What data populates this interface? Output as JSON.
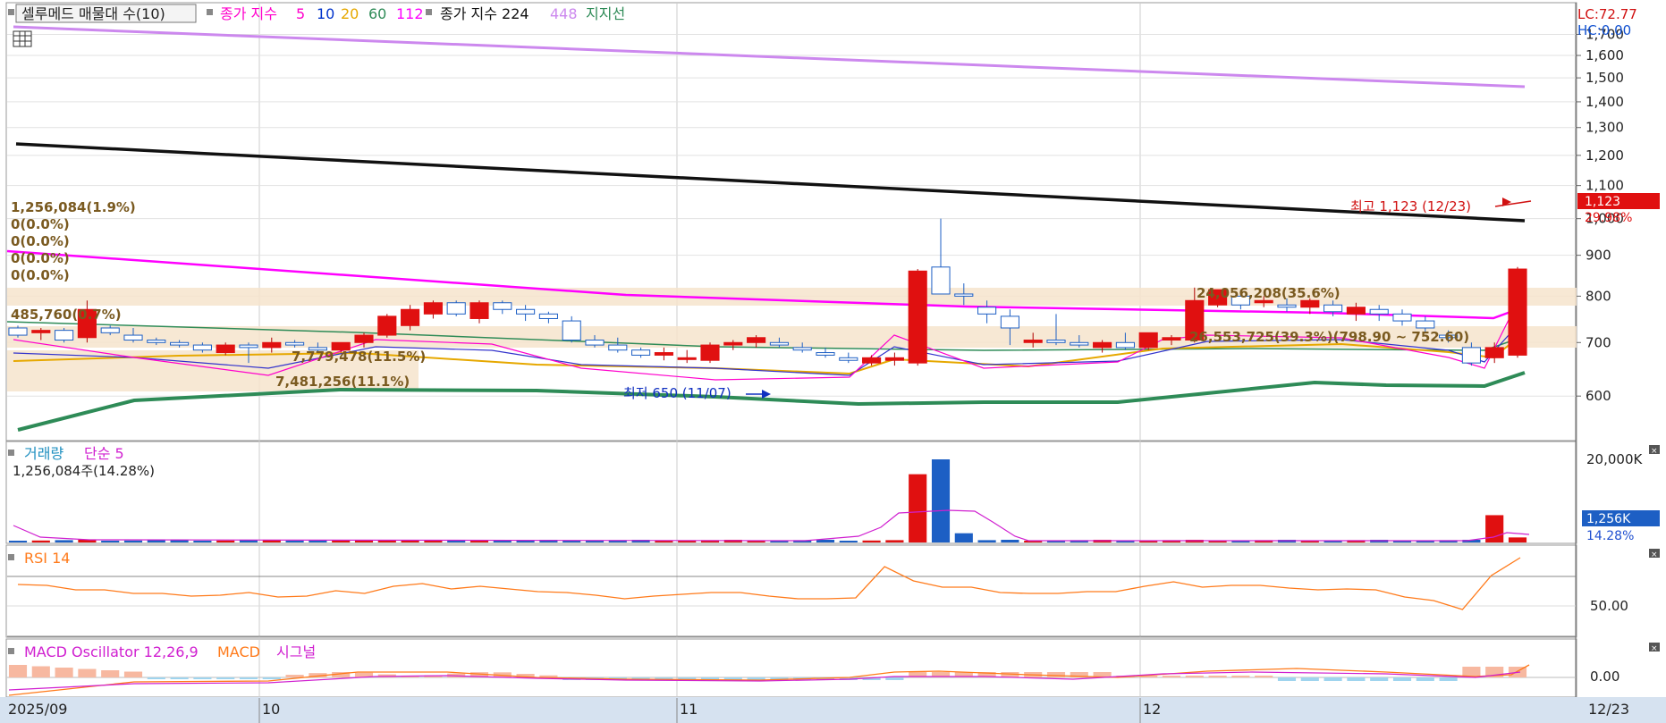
{
  "header": {
    "volume_profile_btn": "셀루메드 매물대 수(10)",
    "ma_label": "종가 지수",
    "ma_periods": [
      "5",
      "10",
      "20",
      "60",
      "112"
    ],
    "ma_colors": [
      "#ff00cc",
      "#0033cc",
      "#e6a800",
      "#2e8b57",
      "#ff00ff"
    ],
    "ma2_label": "종가 지수 224",
    "ma2_period_448": "448",
    "support_line": "지지선",
    "lc": "LC:72.77",
    "hc": "HC:0.00"
  },
  "price_panel": {
    "y_ticks": [
      "1,700",
      "1,600",
      "1,500",
      "1,400",
      "1,300",
      "1,200",
      "1,100",
      "1,000",
      "900",
      "800",
      "700",
      "600"
    ],
    "last_price_box": "1,123",
    "last_price_pct": "29.98%",
    "high_annotation": "최고 1,123 (12/23)",
    "low_annotation": "최저 650 (11/07)",
    "range_annotation": "26,553,725(39.3%)(798.90 ~ 752.60)",
    "profile_labels": [
      "1,256,084(1.9%)",
      "0(0.0%)",
      "0(0.0%)",
      "0(0.0%)",
      "0(0.0%)",
      "24,056,208(35.6%)",
      "485,760(0.7%)",
      "7,779,478(11.5%)",
      "7,481,256(11.1%)"
    ]
  },
  "volume_panel": {
    "title": "거래량",
    "ma_label": "단순 5",
    "current": "1,256,084주(14.28%)",
    "y_tick": "20,000K",
    "last_box": "1,256K",
    "last_pct": "14.28%"
  },
  "rsi_panel": {
    "title": "RSI 14",
    "y_tick": "50.00"
  },
  "macd_panel": {
    "title": "MACD Oscillator 12,26,9",
    "macd": "MACD",
    "signal": "시그널",
    "y_tick": "0.00"
  },
  "x_axis": {
    "labels": [
      "2025/09",
      "10",
      "11",
      "12"
    ],
    "last": "12/23"
  },
  "chart_data": {
    "type": "candlestick",
    "title": "셀루메드",
    "ylim": [
      560,
      1760
    ],
    "candles": [
      [
        730,
        735,
        710,
        715
      ],
      [
        720,
        730,
        705,
        725
      ],
      [
        725,
        730,
        700,
        705
      ],
      [
        710,
        790,
        700,
        770
      ],
      [
        730,
        735,
        715,
        720
      ],
      [
        715,
        730,
        700,
        705
      ],
      [
        705,
        710,
        695,
        700
      ],
      [
        700,
        705,
        690,
        695
      ],
      [
        695,
        700,
        680,
        685
      ],
      [
        680,
        700,
        675,
        695
      ],
      [
        695,
        700,
        660,
        690
      ],
      [
        690,
        710,
        680,
        700
      ],
      [
        700,
        705,
        690,
        695
      ],
      [
        690,
        700,
        680,
        685
      ],
      [
        685,
        700,
        680,
        700
      ],
      [
        700,
        720,
        690,
        715
      ],
      [
        715,
        760,
        710,
        755
      ],
      [
        735,
        780,
        725,
        770
      ],
      [
        760,
        790,
        750,
        785
      ],
      [
        785,
        790,
        755,
        760
      ],
      [
        750,
        790,
        740,
        785
      ],
      [
        785,
        790,
        760,
        770
      ],
      [
        770,
        780,
        745,
        760
      ],
      [
        760,
        765,
        740,
        750
      ],
      [
        745,
        755,
        700,
        705
      ],
      [
        705,
        715,
        690,
        695
      ],
      [
        695,
        710,
        680,
        685
      ],
      [
        685,
        690,
        670,
        675
      ],
      [
        675,
        690,
        665,
        680
      ],
      [
        670,
        685,
        660,
        670
      ],
      [
        665,
        700,
        660,
        695
      ],
      [
        695,
        705,
        685,
        700
      ],
      [
        700,
        715,
        690,
        710
      ],
      [
        700,
        710,
        690,
        695
      ],
      [
        690,
        700,
        680,
        685
      ],
      [
        680,
        690,
        670,
        675
      ],
      [
        670,
        680,
        660,
        665
      ],
      [
        660,
        675,
        655,
        670
      ],
      [
        665,
        680,
        655,
        670
      ],
      [
        660,
        865,
        655,
        860
      ],
      [
        870,
        1000,
        835,
        805
      ],
      [
        805,
        830,
        780,
        800
      ],
      [
        775,
        790,
        740,
        760
      ],
      [
        755,
        770,
        695,
        730
      ],
      [
        700,
        720,
        690,
        705
      ],
      [
        705,
        760,
        695,
        700
      ],
      [
        700,
        715,
        690,
        695
      ],
      [
        690,
        705,
        680,
        700
      ],
      [
        700,
        720,
        685,
        690
      ],
      [
        690,
        720,
        685,
        720
      ],
      [
        705,
        715,
        695,
        710
      ],
      [
        705,
        820,
        700,
        790
      ],
      [
        780,
        815,
        775,
        815
      ],
      [
        800,
        815,
        770,
        780
      ],
      [
        785,
        800,
        775,
        790
      ],
      [
        780,
        795,
        765,
        775
      ],
      [
        775,
        795,
        760,
        790
      ],
      [
        780,
        790,
        755,
        765
      ],
      [
        760,
        785,
        745,
        775
      ],
      [
        770,
        780,
        745,
        760
      ],
      [
        760,
        770,
        735,
        745
      ],
      [
        745,
        755,
        720,
        730
      ],
      [
        715,
        725,
        700,
        710
      ],
      [
        690,
        700,
        655,
        660
      ],
      [
        670,
        700,
        660,
        690
      ],
      [
        675,
        870,
        670,
        865
      ]
    ],
    "series": [
      {
        "name": "224",
        "values": [
          1320,
          1055
        ]
      },
      {
        "name": "448",
        "values": [
          1755,
          1545
        ]
      },
      {
        "name": "112",
        "values": [
          985,
          810
        ]
      },
      {
        "name": "60",
        "values": [
          800,
          765
        ]
      },
      {
        "name": "지지선",
        "values": [
          590,
          665,
          655,
          640,
          640,
          680
        ]
      }
    ],
    "volume_peaks": [
      {
        "index": 39,
        "value": 17000
      },
      {
        "index": 40,
        "value": 20700
      },
      {
        "index": 64,
        "value": 6800
      }
    ],
    "rsi": [
      58,
      57,
      52,
      52,
      48,
      48,
      45,
      46,
      49,
      44,
      45,
      51,
      48,
      56,
      59,
      53,
      56,
      53,
      50,
      49,
      46,
      42,
      45,
      47,
      49,
      49,
      45,
      42,
      42,
      43,
      78,
      62,
      55,
      55,
      49,
      48,
      48,
      50,
      50,
      56,
      61,
      55,
      57,
      57,
      54,
      52,
      53,
      52,
      44,
      40,
      30,
      68,
      88
    ],
    "macd_signal": "converging near 0.00"
  }
}
